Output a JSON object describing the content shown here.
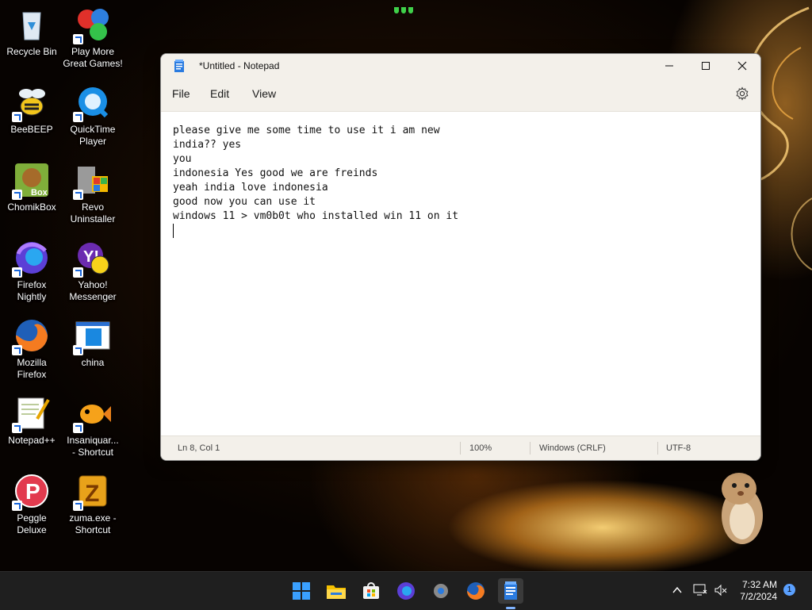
{
  "desktop_icons": [
    {
      "label": "Recycle Bin",
      "icon": "recycle-bin-icon"
    },
    {
      "label": "Play More\nGreat Games!",
      "icon": "games-icon"
    },
    {
      "label": "BeeBEEP",
      "icon": "bee-icon"
    },
    {
      "label": "QuickTime\nPlayer",
      "icon": "quicktime-icon"
    },
    {
      "label": "ChomikBox",
      "icon": "chomikbox-icon"
    },
    {
      "label": "Revo\nUninstaller",
      "icon": "revo-uninstaller-icon"
    },
    {
      "label": "Firefox\nNightly",
      "icon": "firefox-nightly-icon"
    },
    {
      "label": "Yahoo!\nMessenger",
      "icon": "yahoo-messenger-icon"
    },
    {
      "label": "Mozilla\nFirefox",
      "icon": "firefox-icon"
    },
    {
      "label": "china",
      "icon": "shortcut-window-icon"
    },
    {
      "label": "Notepad++",
      "icon": "notepad-plus-plus-icon"
    },
    {
      "label": "Insaniquar...\n- Shortcut",
      "icon": "fish-icon"
    },
    {
      "label": "Peggle\nDeluxe",
      "icon": "peggle-icon"
    },
    {
      "label": "zuma.exe -\nShortcut",
      "icon": "zuma-icon"
    }
  ],
  "notepad": {
    "title": "*Untitled - Notepad",
    "menu": [
      "File",
      "Edit",
      "View"
    ],
    "content": "please give me some time to use it i am new\nindia?? yes\nyou\nindonesia Yes good we are freinds\nyeah india love indonesia\ngood now you can use it\nwindows 11 > vm0b0t who installed win 11 on it\n",
    "status": {
      "position": "Ln 8, Col 1",
      "zoom": "100%",
      "line_ending": "Windows (CRLF)",
      "encoding": "UTF-8"
    }
  },
  "taskbar": {
    "apps": [
      "start-icon",
      "file-explorer-icon",
      "store-icon",
      "firefox-nightly-icon",
      "settings-icon",
      "firefox-icon",
      "notepad-icon"
    ],
    "time": "7:32 AM",
    "date": "7/2/2024",
    "notification_count": "1"
  },
  "colors": {
    "accent": "#1a66d9",
    "taskbar": "#1f1f1f",
    "window_chrome": "#f3f0ea"
  }
}
